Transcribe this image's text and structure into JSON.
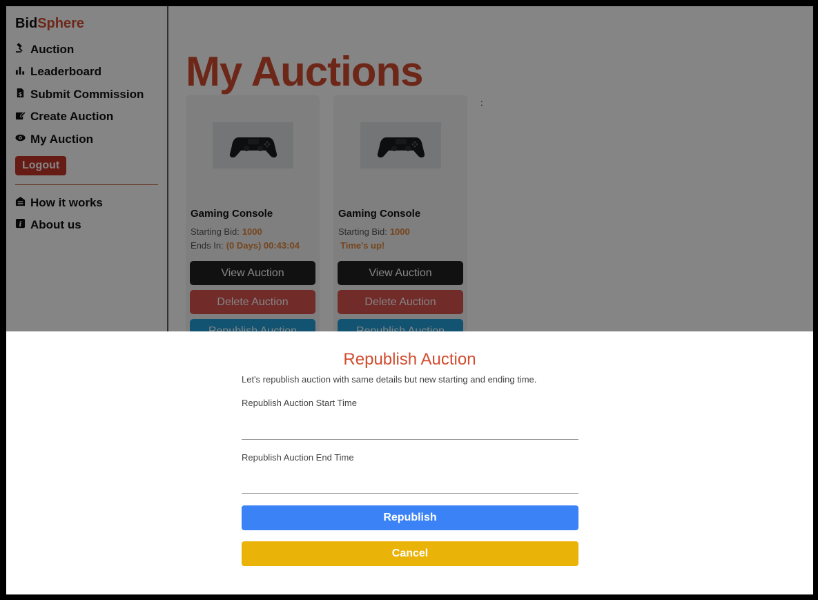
{
  "brand": {
    "part1": "Bid",
    "part2": "Sphere"
  },
  "nav": {
    "auction": "Auction",
    "leaderboard": "Leaderboard",
    "submit_commission": "Submit Commission",
    "create_auction": "Create Auction",
    "my_auction": "My Auction",
    "logout": "Logout",
    "how_it_works": "How it works",
    "about_us": "About us"
  },
  "main": {
    "title": "My Auctions",
    "colon": ":",
    "cards": [
      {
        "name": "Gaming Console",
        "starting_bid_label": "Starting Bid:",
        "starting_bid": "1000",
        "ends_in_label": "Ends In:",
        "ends_in": "(0 Days) 00:43:04",
        "view": "View Auction",
        "delete": "Delete Auction",
        "republish": "Republish Auction"
      },
      {
        "name": "Gaming Console",
        "starting_bid_label": "Starting Bid:",
        "starting_bid": "1000",
        "status": "Time's up!",
        "view": "View Auction",
        "delete": "Delete Auction",
        "republish": "Republish Auction"
      }
    ]
  },
  "modal": {
    "title": "Republish Auction",
    "description": "Let's republish auction with same details but new starting and ending time.",
    "start_label": "Republish Auction Start Time",
    "start_value": "",
    "end_label": "Republish Auction End Time",
    "end_value": "",
    "republish": "Republish",
    "cancel": "Cancel"
  },
  "colors": {
    "accent": "#d24c2f",
    "republish_button": "#3b82f6",
    "cancel_button": "#eab308",
    "delete_button": "#d9534f",
    "view_button": "#222222",
    "card_republish_button": "#22a0d9"
  }
}
